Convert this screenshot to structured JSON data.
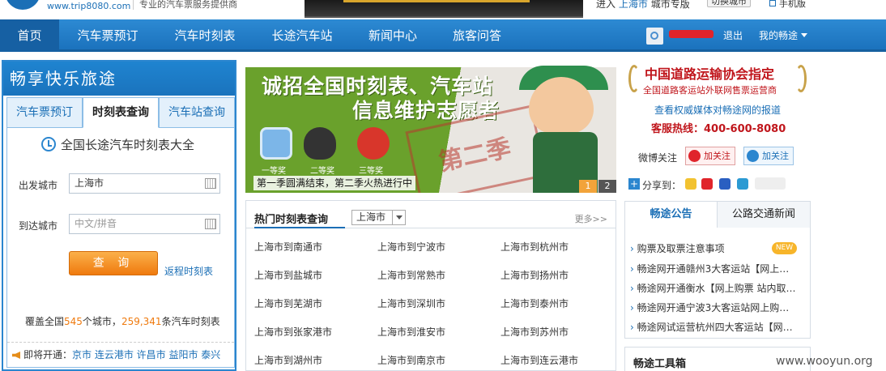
{
  "header": {
    "site_url": "www.trip8080.com",
    "slogan": "专业的汽车票服务提供商",
    "city_prefix": "进入",
    "city": "上海市",
    "city_suffix": "城市专版",
    "switch_city": "切换城市",
    "mobile": "手机版"
  },
  "nav": {
    "items": [
      "首页",
      "汽车票预订",
      "汽车时刻表",
      "长途汽车站",
      "新闻中心",
      "旅客问答"
    ],
    "active_index": 0,
    "logout": "退出",
    "my_account": "我的畅途"
  },
  "left_panel": {
    "title": "畅享快乐旅途",
    "tabs": [
      "汽车票预订",
      "时刻表查询",
      "汽车站查询"
    ],
    "active_tab": 1,
    "form_title": "全国长途汽车时刻表大全",
    "from_label": "出发城市",
    "from_value": "上海市",
    "to_label": "到达城市",
    "to_placeholder": "中文/拼音",
    "query_button": "查 询",
    "return_link": "返程时刻表",
    "cover_prefix": "覆盖全国",
    "city_count": "545",
    "cover_mid": "个城市，",
    "timetable_count": "259,341",
    "cover_suffix": "条汽车时刻表",
    "opening_label": "即将开通：",
    "opening_cities": "京市 连云港市 许昌市 益阳市 泰兴"
  },
  "banner": {
    "line1": "诚招全国时刻表、汽车站",
    "line2": "信息维护志愿者",
    "prizes": [
      "一等奖",
      "二等奖",
      "三等奖"
    ],
    "stamp": "第二季",
    "caption": "第一季圆满结束，第二季火热进行中",
    "pages": [
      "1",
      "2"
    ],
    "active_page": 0
  },
  "hot": {
    "title": "热门时刻表查询",
    "city_select": "上海市",
    "more": "更多>>",
    "routes": [
      [
        "上海市到南通市",
        "上海市到宁波市",
        "上海市到杭州市"
      ],
      [
        "上海市到盐城市",
        "上海市到常熟市",
        "上海市到扬州市"
      ],
      [
        "上海市到芜湖市",
        "上海市到深圳市",
        "上海市到泰州市"
      ],
      [
        "上海市到张家港市",
        "上海市到淮安市",
        "上海市到苏州市"
      ],
      [
        "上海市到湖州市",
        "上海市到南京市",
        "上海市到连云港市"
      ]
    ]
  },
  "right": {
    "badge_title": "中国道路运输协会指定",
    "badge_sub": "全国道路客运站外联网售票运营商",
    "media_link": "查看权威媒体对畅途网的报道",
    "hotline": "客服热线：400-600-8080",
    "weibo_label": "微博关注",
    "weibo_follow": "加关注",
    "qq_follow": "加关注",
    "share_label": "分享到：",
    "notice_tabs": [
      "畅途公告",
      "公路交通新闻"
    ],
    "notices": [
      "购票及取票注意事项",
      "畅途网开通赣州3大客运站【网上…",
      "畅途网开通衡水【网上购票 站内取…",
      "畅途网开通宁波3大客运站网上购…",
      "畅途网试运营杭州四大客运站【网…"
    ],
    "new_badge": "NEW",
    "tools_title": "畅途工具箱",
    "watermark": "www.wooyun.org"
  },
  "colors": {
    "brand_blue": "#1b72bd",
    "accent_orange": "#ef7a0e",
    "alert_red": "#c0161c"
  }
}
